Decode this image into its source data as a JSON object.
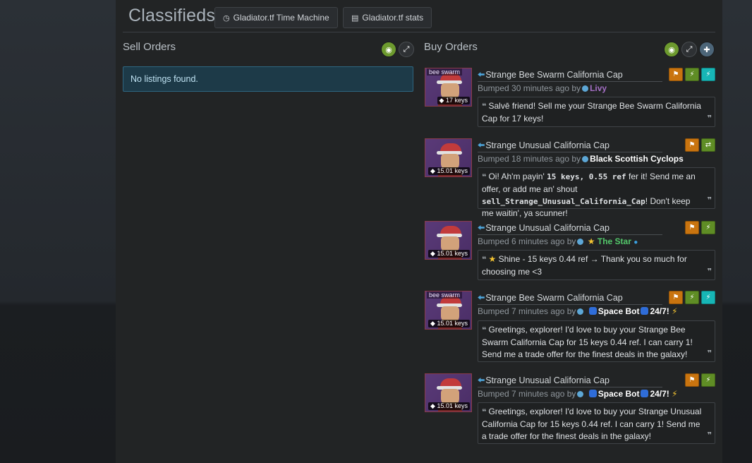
{
  "header": {
    "title": "Classifieds",
    "btn_time_machine": "Gladiator.tf Time Machine",
    "btn_stats": "Gladiator.tf stats"
  },
  "sell": {
    "title": "Sell Orders",
    "empty": "No listings found."
  },
  "buy": {
    "title": "Buy Orders",
    "listings": [
      {
        "name": "Strange Bee Swarm California Cap",
        "effect": "bee swarm",
        "price": "17 keys",
        "bumped": "Bumped 30 minutes ago by",
        "user": "Livy",
        "quote": "Salvē friend! Sell me your Strange Bee Swarm California Cap for 17 keys!"
      },
      {
        "name": "Strange Unusual California Cap",
        "effect": "",
        "price": "15.01 keys",
        "bumped": "Bumped 18 minutes ago by",
        "user": "Black Scottish Cyclops",
        "quote_parts": [
          "Oi! Ah'm payin' ",
          "15 keys, 0.55 ref",
          " fer it! Send me an offer, or add me an' shout ",
          "sell_Strange_Unusual_California_Cap",
          "! Don't keep me waitin', ya scunner!"
        ]
      },
      {
        "name": "Strange Unusual California Cap",
        "effect": "",
        "price": "15.01 keys",
        "bumped": "Bumped 6 minutes ago by",
        "user": "The Star",
        "quote": "Shine - 15 keys 0.44 ref → Thank you so much for choosing me <3"
      },
      {
        "name": "Strange Bee Swarm California Cap",
        "effect": "bee swarm",
        "price": "15.01 keys",
        "bumped": "Bumped 7 minutes ago by",
        "user": "Space Bot",
        "user_suffix": "24/7!",
        "quote": "Greetings, explorer! I'd love to buy your Strange Bee Swarm California Cap for 15 keys 0.44 ref. I can carry 1! Send me a trade offer for the finest deals in the galaxy!"
      },
      {
        "name": "Strange Unusual California Cap",
        "effect": "",
        "price": "15.01 keys",
        "bumped": "Bumped 7 minutes ago by",
        "user": "Space Bot",
        "user_suffix": "24/7!",
        "quote": "Greetings, explorer! I'd love to buy your Strange Unusual California Cap for 15 keys 0.44 ref. I can carry 1! Send me a trade offer for the finest deals in the galaxy!"
      }
    ]
  },
  "icons": {
    "time_machine": "clock-icon",
    "stats": "bar-chart-icon",
    "eye": "eye-icon",
    "expand": "expand-icon",
    "add": "plus-icon",
    "flag": "flag-icon",
    "bolt": "lightning-icon",
    "trade": "exchange-icon",
    "tag": "tag-icon"
  },
  "colors": {
    "accent_blue": "#4ea6dc",
    "badge_orange": "#c9740f",
    "badge_green": "#5f8d25",
    "badge_cyan": "#17b6b6"
  }
}
